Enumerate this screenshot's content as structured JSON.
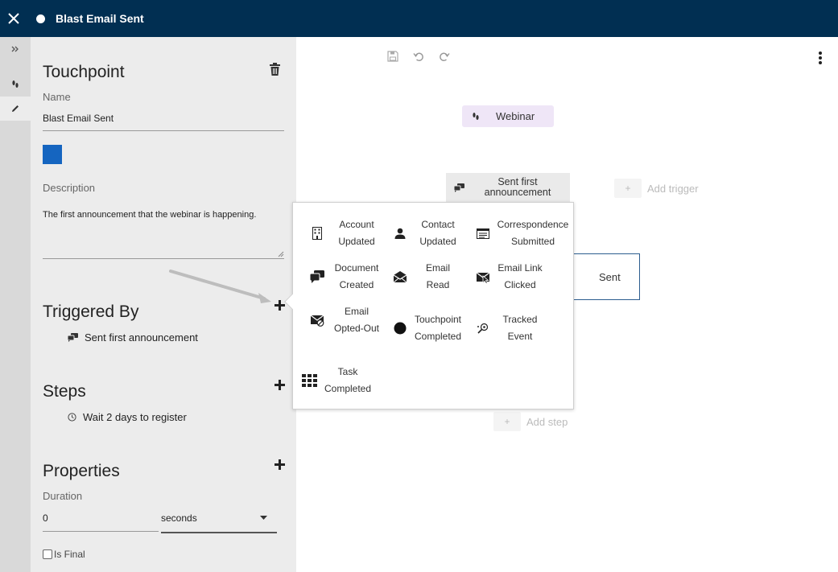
{
  "topbar": {
    "title": "Blast Email Sent",
    "close_icon": "close-icon",
    "status_icon": "dot-icon"
  },
  "rail": {
    "items": [
      {
        "icon": "expand-icon"
      },
      {
        "icon": "footsteps-icon"
      },
      {
        "icon": "pencil-icon"
      }
    ]
  },
  "panel": {
    "heading": "Touchpoint",
    "name_label": "Name",
    "name_value": "Blast Email Sent",
    "color": "#1565c0",
    "description_label": "Description",
    "description_value": "The first announcement that the webinar is happening.",
    "triggered_heading": "Triggered By",
    "triggers": [
      {
        "label": "Sent first announcement",
        "icon": "chat-bubbles-icon"
      }
    ],
    "steps_heading": "Steps",
    "steps": [
      {
        "label": "Wait 2 days to register",
        "icon": "clock-icon"
      }
    ],
    "properties_heading": "Properties",
    "duration_label": "Duration",
    "duration_value": "0",
    "duration_unit": "seconds",
    "is_final_label": "Is Final"
  },
  "canvas": {
    "webinar_label": "Webinar",
    "sent_label": "Sent first announcement",
    "add_trigger_label": "Add trigger",
    "bordered_node_label": "Sent",
    "add_step_label": "Add step",
    "plus_symbol": "+"
  },
  "popup": {
    "options": [
      {
        "label": "Account Updated",
        "icon": "building-icon"
      },
      {
        "label": "Contact Updated",
        "icon": "person-icon"
      },
      {
        "label": "Correspondence Submitted",
        "icon": "form-icon"
      },
      {
        "label": "Document Created",
        "icon": "chat-bubbles-icon"
      },
      {
        "label": "Email Read",
        "icon": "open-envelope-icon"
      },
      {
        "label": "Email Link Clicked",
        "icon": "envelope-cursor-icon"
      },
      {
        "label": "Email Opted-Out",
        "icon": "envelope-blocked-icon"
      },
      {
        "label": "Touchpoint Completed",
        "icon": "circle-icon"
      },
      {
        "label": "Tracked Event",
        "icon": "tracked-event-icon"
      },
      {
        "label": "Task Completed",
        "icon": "grid-icon"
      }
    ]
  }
}
